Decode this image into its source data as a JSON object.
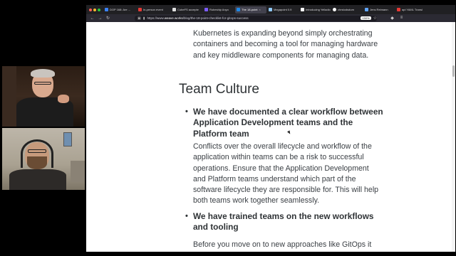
{
  "browser": {
    "tabs": [
      {
        "label": "DOP 168: Are ...",
        "color": "#3b82f6",
        "active": false
      },
      {
        "label": "In-person event",
        "color": "#e53935",
        "active": false
      },
      {
        "label": "CubeFS accepte",
        "color": "#e0e0e0",
        "active": false
      },
      {
        "label": "Rubeship Anyo",
        "color": "#7c5cff",
        "active": false
      },
      {
        "label": "The 18-point",
        "color": "#1e88e5",
        "active": true
      },
      {
        "label": "Megapoint 0.9",
        "color": "#90caf9",
        "active": false
      },
      {
        "label": "Introducing Yelladio",
        "color": "#ffffff",
        "active": false
      },
      {
        "label": "chrstodsdum",
        "color": "#ffffff",
        "active": false
      },
      {
        "label": "Jens Reimann",
        "color": "#60a5fa",
        "active": false
      },
      {
        "label": "api YAML Transl",
        "color": "#e53935",
        "active": false
      }
    ],
    "address": {
      "prefix": "https://www.",
      "domain": "weave.works",
      "path": "/blog/the-18-point-checklist-for-gitops-success"
    },
    "zoom": "150%"
  },
  "article": {
    "intro": "Kubernetes is expanding beyond simply orchestrating containers and becoming a tool for managing hardware and key middleware components for managing data.",
    "heading": "Team Culture",
    "bullet1": "We have documented a clear workflow between Application Development teams and the Platform team",
    "para1": "Conflicts over the overall lifecycle and workflow of the application within teams can be a risk to successful operations. Ensure that the Application Development and Platform teams understand which part of the software lifecycle they are responsible for. This will help both teams work together seamlessly.",
    "bullet2": "We have trained teams on the new workflows and tooling",
    "para2": "Before you move on to new approaches like GitOps it"
  },
  "colors": {
    "chrome_dark": "#202023",
    "active_tab": "#42414d",
    "text": "#3a3f44",
    "heading": "#2f3336"
  },
  "icons": [
    "back-arrow-icon",
    "forward-arrow-icon",
    "reload-icon",
    "lock-icon",
    "star-icon",
    "extensions-icon",
    "menu-icon"
  ]
}
